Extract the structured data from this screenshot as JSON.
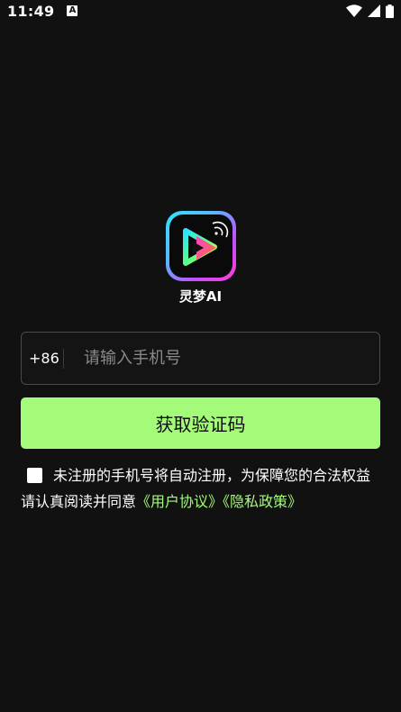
{
  "status_bar": {
    "time": "11:49",
    "notification_icon_letter": "A",
    "icons": [
      "wifi-icon",
      "signal-icon",
      "battery-icon"
    ]
  },
  "app": {
    "name": "灵梦AI",
    "logo_icon": "play-cast-logo-icon"
  },
  "login": {
    "country_code": "+86",
    "phone_placeholder": "请输入手机号",
    "phone_value": "",
    "get_code_label": "获取验证码"
  },
  "agreement": {
    "checked": false,
    "text": "未注册的手机号将自动注册，为保障您的合法权益请认真阅读并同意",
    "user_agreement": "《用户协议》",
    "privacy_policy": "《隐私政策》"
  },
  "colors": {
    "background": "#111111",
    "accent": "#a3fb79",
    "input_border": "#4a4a4a",
    "placeholder": "#8a8a8a"
  }
}
